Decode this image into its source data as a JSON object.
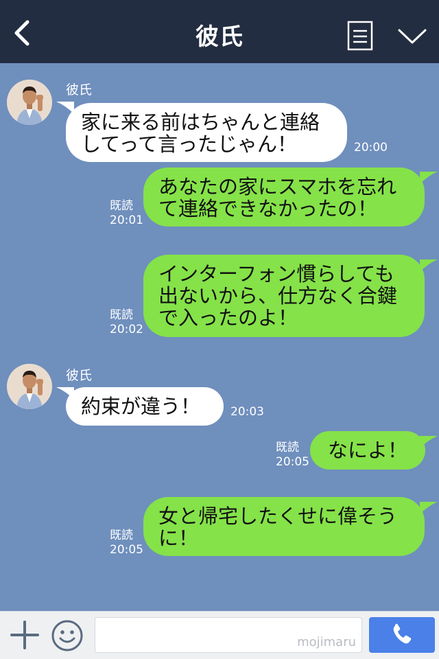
{
  "header": {
    "title": "彼氏"
  },
  "messages": [
    {
      "direction": "in",
      "sender": "彼氏",
      "text": "家に来る前はちゃんと連絡\nしてって言ったじゃん！",
      "time": "20:00"
    },
    {
      "direction": "out",
      "read": "既読",
      "time": "20:01",
      "text": "あなたの家にスマホを忘れ\nて連絡できなかったの！"
    },
    {
      "direction": "out",
      "read": "既読",
      "time": "20:02",
      "text": "インターフォン慣らしても\n出ないから、仕方なく合鍵\nで入ったのよ！"
    },
    {
      "direction": "in",
      "sender": "彼氏",
      "text": "約束が違う！",
      "time": "20:03"
    },
    {
      "direction": "out",
      "read": "既読",
      "time": "20:05",
      "text": "なによ！"
    },
    {
      "direction": "out",
      "read": "既読",
      "time": "20:05",
      "text": "女と帰宅したくせに偉そう\nに！"
    }
  ],
  "input": {
    "watermark": "mojimaru"
  },
  "colors": {
    "header_bg": "#232d41",
    "chat_bg": "#6f8fbd",
    "outgoing_bubble": "#85e249",
    "incoming_bubble": "#ffffff",
    "call_button": "#4a80e8"
  },
  "icons": {
    "back": "chevron-left-icon",
    "menu": "document-menu-icon",
    "collapse": "chevron-down-icon",
    "add": "plus-icon",
    "emoji": "smiley-icon",
    "call": "phone-icon"
  }
}
